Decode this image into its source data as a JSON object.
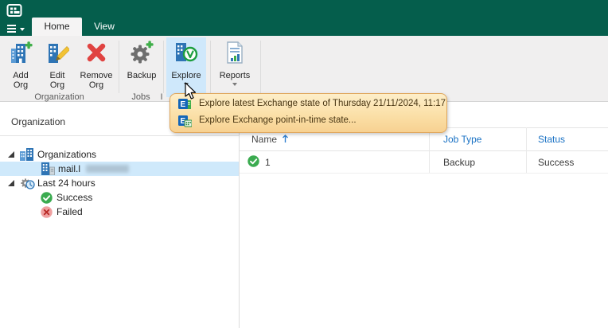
{
  "tabs": {
    "home": "Home",
    "view": "View"
  },
  "ribbon": {
    "buttons": {
      "add_org": {
        "line1": "Add",
        "line2": "Org"
      },
      "edit_org": {
        "line1": "Edit",
        "line2": "Org"
      },
      "remove_org": {
        "line1": "Remove",
        "line2": "Org"
      },
      "backup": {
        "label": "Backup"
      },
      "explore": {
        "label": "Explore"
      },
      "reports": {
        "label": "Reports"
      }
    },
    "group_labels": {
      "organization": "Organization",
      "jobs": "Jobs",
      "partial": "I"
    }
  },
  "explore_menu": {
    "items": [
      {
        "icon": "exchange-latest-icon",
        "label": "Explore latest Exchange state of Thursday 21/11/2024, 11:17"
      },
      {
        "icon": "exchange-point-in-time-icon",
        "label": "Explore Exchange point-in-time state..."
      }
    ]
  },
  "sidebar": {
    "header": "Organization",
    "items": [
      {
        "label": "Organizations",
        "icon": "organizations-icon",
        "expanded": true
      },
      {
        "label": "mail.l",
        "redacted": true,
        "icon": "organization-icon",
        "selected": true
      },
      {
        "label": "Last 24 hours",
        "icon": "last-24-hours-icon",
        "expanded": true
      },
      {
        "label": "Success",
        "icon": "success-icon"
      },
      {
        "label": "Failed",
        "icon": "failed-icon"
      }
    ]
  },
  "table": {
    "columns": [
      {
        "label": "Name",
        "sorted": "asc"
      },
      {
        "label": "Job Type"
      },
      {
        "label": "Status"
      }
    ],
    "rows": [
      {
        "name": "1",
        "job_type": "Backup",
        "status": "Success",
        "status_icon": "success-icon"
      }
    ]
  },
  "colors": {
    "titlebar_green": "#055E4C",
    "ribbon_bg": "#F0EFEF",
    "explore_button_highlight": "#CFE8FB",
    "menu_bg_top": "#FDEEC9",
    "menu_bg_bottom": "#F7D191",
    "menu_border": "#DFA65C",
    "column_header_blue": "#1A72C4",
    "tree_selection_blue": "#CFE9FB",
    "success_green": "#3BAB50",
    "failed_red": "#C94444"
  }
}
